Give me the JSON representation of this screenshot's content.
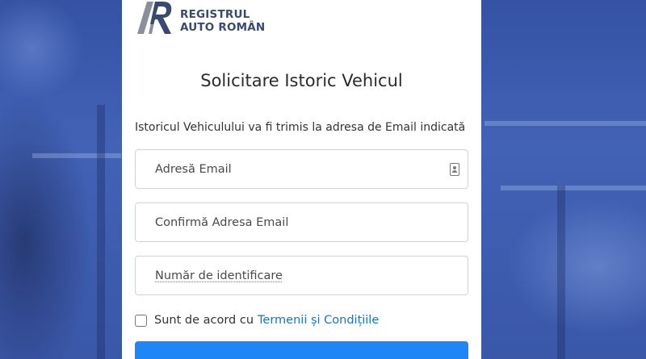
{
  "brand": {
    "line1": "REGISTRUL",
    "line2": "AUTO ROMÂN"
  },
  "form": {
    "title": "Solicitare Istoric Vehicul",
    "subtitle": "Istoricul Vehiculului va fi trimis la adresa de Email indicată",
    "email_placeholder": "Adresă Email",
    "email_confirm_placeholder": "Confirmă Adresa Email",
    "id_placeholder": "Număr de identificare",
    "terms_prefix": "Sunt de acord cu",
    "terms_link": "Termenii și Condițiile",
    "terms_checked": false
  },
  "colors": {
    "background": "#3d5aa8",
    "link": "#1a73c9",
    "button": "#1f86f5"
  },
  "icons": {
    "email_field_icon": "contact-card-icon"
  }
}
